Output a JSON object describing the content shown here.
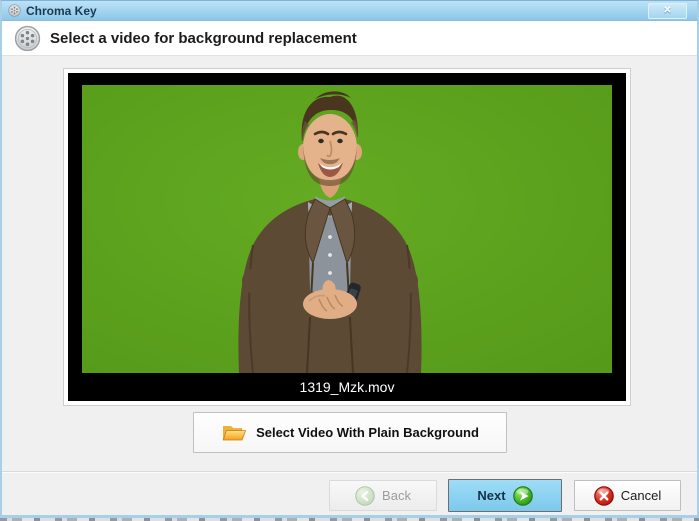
{
  "window": {
    "title": "Chroma Key",
    "close_glyph": "✕"
  },
  "header": {
    "title": "Select a video for background replacement"
  },
  "preview": {
    "filename": "1319_Mzk.mov"
  },
  "buttons": {
    "select_video": "Select Video With Plain Background",
    "back": "Back",
    "next": "Next",
    "cancel": "Cancel"
  },
  "colors": {
    "chroma_green": "#5ea41f",
    "titlebar_blue": "#9fd3ee",
    "next_button_blue": "#8ed4f3",
    "folder_orange": "#f3a51d",
    "next_icon_green": "#3aa81f",
    "cancel_icon_red": "#d5281b",
    "back_disabled_text": "#9d9d9d"
  },
  "icons": {
    "titlebar_icon": "film-reel-icon",
    "header_icon": "film-reel-icon",
    "select_video_icon": "folder-open-icon",
    "back_icon": "back-circle-arrow-icon",
    "next_icon": "next-circle-arrow-icon",
    "cancel_icon": "cancel-circle-x-icon",
    "close_icon": "close-icon"
  }
}
